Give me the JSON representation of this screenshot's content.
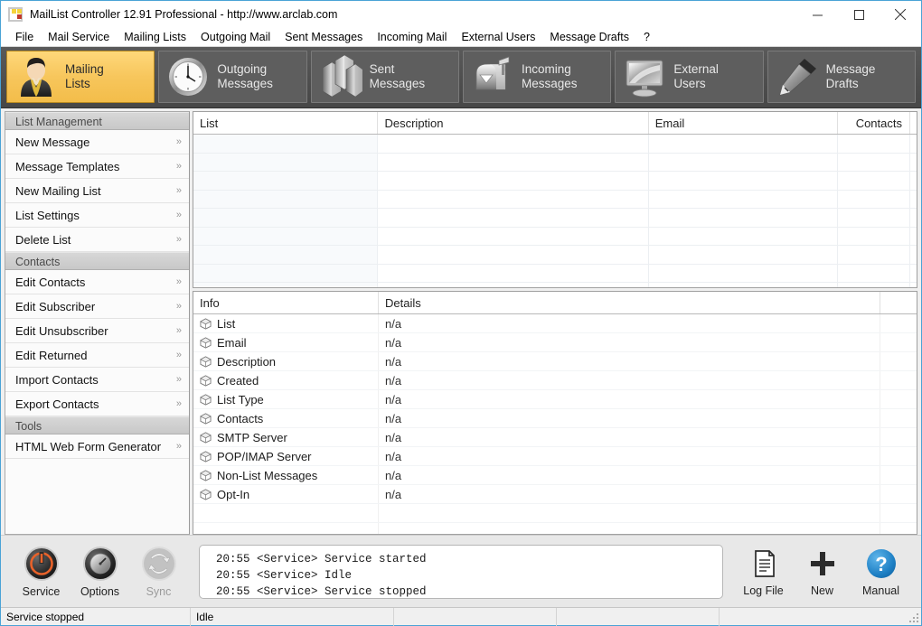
{
  "window": {
    "title": "MailList Controller 12.91 Professional - http://www.arclab.com",
    "minimize_label": "Minimize",
    "maximize_label": "Maximize",
    "close_label": "Close"
  },
  "menubar": {
    "items": [
      {
        "label": "File"
      },
      {
        "label": "Mail Service"
      },
      {
        "label": "Mailing Lists"
      },
      {
        "label": "Outgoing Mail"
      },
      {
        "label": "Sent Messages"
      },
      {
        "label": "Incoming Mail"
      },
      {
        "label": "External Users"
      },
      {
        "label": "Message Drafts"
      },
      {
        "label": "?"
      }
    ]
  },
  "toolbar": {
    "buttons": [
      {
        "label": "Mailing\nLists",
        "icon": "person-icon",
        "active": true
      },
      {
        "label": "Outgoing\nMessages",
        "icon": "clock-icon",
        "active": false
      },
      {
        "label": "Sent\nMessages",
        "icon": "boxes-icon",
        "active": false
      },
      {
        "label": "Incoming\nMessages",
        "icon": "mailbox-icon",
        "active": false
      },
      {
        "label": "External\nUsers",
        "icon": "monitor-icon",
        "active": false
      },
      {
        "label": "Message\nDrafts",
        "icon": "fountain-pen-icon",
        "active": false
      }
    ]
  },
  "sidebar": {
    "sections": [
      {
        "header": "List Management",
        "items": [
          {
            "label": "New Message"
          },
          {
            "label": "Message Templates"
          },
          {
            "label": "New Mailing List"
          },
          {
            "label": "List Settings"
          },
          {
            "label": "Delete List"
          }
        ]
      },
      {
        "header": "Contacts",
        "items": [
          {
            "label": "Edit Contacts"
          },
          {
            "label": "Edit Subscriber"
          },
          {
            "label": "Edit Unsubscriber"
          },
          {
            "label": "Edit Returned"
          },
          {
            "label": "Import Contacts"
          },
          {
            "label": "Export Contacts"
          }
        ]
      },
      {
        "header": "Tools",
        "items": [
          {
            "label": "HTML Web Form Generator"
          }
        ]
      }
    ],
    "chevron": "»"
  },
  "list_grid": {
    "columns": [
      "List",
      "Description",
      "Email",
      "Contacts"
    ],
    "rows": []
  },
  "info_grid": {
    "columns": [
      "Info",
      "Details"
    ],
    "rows": [
      {
        "key": "List",
        "value": "n/a"
      },
      {
        "key": "Email",
        "value": "n/a"
      },
      {
        "key": "Description",
        "value": "n/a"
      },
      {
        "key": "Created",
        "value": "n/a"
      },
      {
        "key": "List Type",
        "value": "n/a"
      },
      {
        "key": "Contacts",
        "value": "n/a"
      },
      {
        "key": "SMTP Server",
        "value": "n/a"
      },
      {
        "key": "POP/IMAP Server",
        "value": "n/a"
      },
      {
        "key": "Non-List Messages",
        "value": "n/a"
      },
      {
        "key": "Opt-In",
        "value": "n/a"
      }
    ]
  },
  "bottombar": {
    "left_buttons": [
      {
        "label": "Service",
        "icon": "power-icon",
        "disabled": false
      },
      {
        "label": "Options",
        "icon": "dial-icon",
        "disabled": false
      },
      {
        "label": "Sync",
        "icon": "refresh-icon",
        "disabled": true
      }
    ],
    "right_buttons": [
      {
        "label": "Log File",
        "icon": "document-icon",
        "disabled": false
      },
      {
        "label": "New",
        "icon": "plus-icon",
        "disabled": false
      },
      {
        "label": "Manual",
        "icon": "help-icon",
        "disabled": false
      }
    ],
    "log_lines": [
      "20:55 <Service> Service started",
      "20:55 <Service> Idle",
      "20:55 <Service> Service stopped"
    ]
  },
  "statusbar": {
    "cells": [
      "Service stopped",
      "Idle",
      "",
      "",
      ""
    ]
  },
  "colors": {
    "accent_active": "#f7c65c",
    "toolbar_bg": "#525252",
    "window_border": "#4aa3d6",
    "help_blue": "#1d7fc4",
    "power_orange": "#e8622a"
  }
}
